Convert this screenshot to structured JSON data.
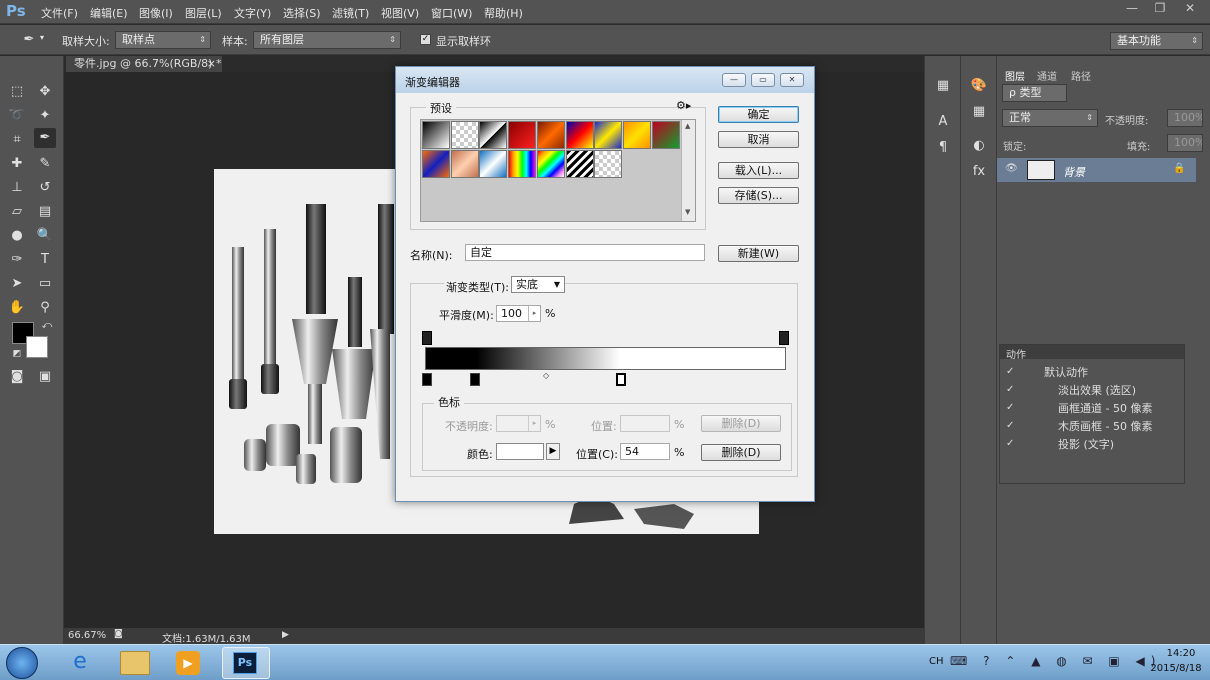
{
  "app": {
    "logo": "Ps",
    "menu": [
      "文件(F)",
      "编辑(E)",
      "图像(I)",
      "图层(L)",
      "文字(Y)",
      "选择(S)",
      "滤镜(T)",
      "视图(V)",
      "窗口(W)",
      "帮助(H)"
    ],
    "window_controls": [
      "—",
      "❐",
      "✕"
    ]
  },
  "options_bar": {
    "sample_size_label": "取样大小:",
    "sample_size_value": "取样点",
    "sample_label": "样本:",
    "sample_value": "所有图层",
    "show_ring_label": "显示取样环",
    "show_ring_checked": true,
    "workspace": "基本功能"
  },
  "document": {
    "tab_title": "零件.jpg @ 66.7%(RGB/8) *",
    "tab_close": "×",
    "zoom": "66.67%",
    "doc_size": "文档:1.63M/1.63M"
  },
  "layers_panel": {
    "tabs": [
      "图层",
      "通道",
      "路径"
    ],
    "filter_label": "ρ 类型",
    "blend_mode": "正常",
    "opacity_label": "不透明度:",
    "opacity_value": "100%",
    "lock_label": "锁定:",
    "fill_label": "填充:",
    "fill_value": "100%",
    "layer_name": "背景"
  },
  "actions_panel": {
    "title": "动作",
    "items": [
      "默认动作",
      "淡出效果 (选区)",
      "画框通道 - 50 像素",
      "木质画框 - 50 像素",
      "投影 (文字)"
    ]
  },
  "dialog": {
    "title": "渐变编辑器",
    "presets_label": "预设",
    "ok": "确定",
    "cancel": "取消",
    "load": "载入(L)...",
    "save": "存储(S)...",
    "name_label": "名称(N):",
    "name_value": "自定",
    "new_button": "新建(W)",
    "gradient_type_label": "渐变类型(T):",
    "gradient_type_value": "实底",
    "smoothness_label": "平滑度(M):",
    "smoothness_value": "100",
    "percent": "%",
    "stops_label": "色标",
    "opacity_label": "不透明度:",
    "position_label": "位置:",
    "delete_button": "删除(D)",
    "color_label": "颜色:",
    "color_position_label": "位置(C):",
    "color_position_value": "54",
    "preset_gradients": [
      "linear-gradient(135deg,#000,#fff)",
      "repeating-conic-gradient(#ccc 0 25%,#fff 0 50%) 0 0/8px 8px",
      "linear-gradient(135deg,#000,#fff 50%,#000 50%,#fff)",
      "linear-gradient(135deg,#8b0000,#ff2020)",
      "linear-gradient(135deg,#7a1a00,#ff6a00,#8b2a00)",
      "linear-gradient(135deg,#0000b0,#ff0000,#ffff00)",
      "linear-gradient(135deg,#1a2ad0,#ffe800,#1a2ad0)",
      "linear-gradient(135deg,#ff9000,#ffe000,#ff9000)",
      "linear-gradient(135deg,#c00020,#10a030)",
      "linear-gradient(135deg,#ff6a00,#1020c0,#ff6a00)",
      "linear-gradient(135deg,#c07050,#ffd0b0,#c07050)",
      "linear-gradient(135deg,#1070c0,#ffffff,#1070c0)",
      "linear-gradient(90deg,red,orange,yellow,lime,cyan,blue,magenta)",
      "linear-gradient(135deg,red,orange,yellow,lime,cyan,blue,violet,#fff)",
      "repeating-linear-gradient(135deg,#000 0 3px,#fff 3px 6px)",
      "repeating-conic-gradient(#ccc 0 25%,#fff 0 50%) 0 0/8px 8px"
    ]
  },
  "taskbar": {
    "time": "14:20",
    "date": "2015/8/18",
    "lang": "CH"
  }
}
